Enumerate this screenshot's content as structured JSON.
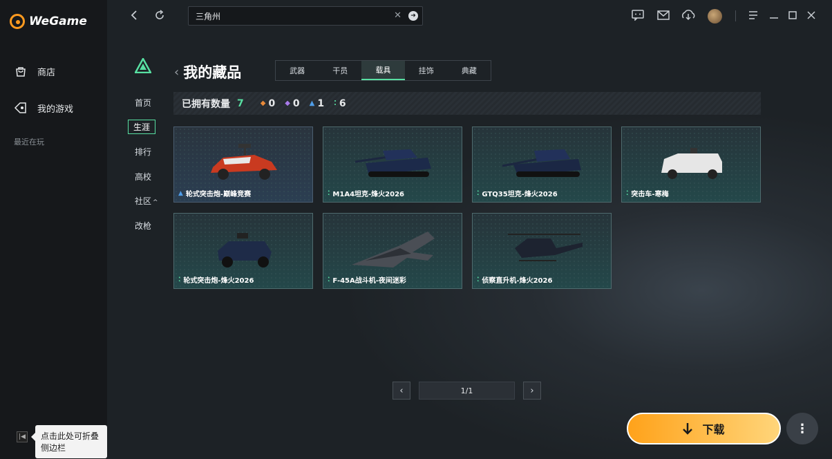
{
  "sidebar": {
    "brand": "WeGame",
    "items": [
      {
        "label": "商店",
        "icon": "shop-bag-icon"
      },
      {
        "label": "我的游戏",
        "icon": "game-controller-icon"
      }
    ],
    "recent_label": "最近在玩",
    "collapse_tooltip": "点击此处可折叠侧边栏"
  },
  "topbar": {
    "search_value": "三角州"
  },
  "game_menu": {
    "items": [
      "首页",
      "生涯",
      "排行",
      "高校",
      "社区",
      "改枪"
    ],
    "active": "生涯"
  },
  "page": {
    "title": "我的藏品",
    "tabs": [
      "武器",
      "干员",
      "载具",
      "挂饰",
      "典藏"
    ],
    "active_tab": "载具",
    "stats": {
      "owned_label": "已拥有数量",
      "owned_count": "7",
      "orange": "0",
      "purple": "0",
      "blue": "1",
      "green": "6"
    }
  },
  "items": [
    {
      "name": "轮式突击炮-巅峰竞赛",
      "rarity": "blue"
    },
    {
      "name": "M1A4坦克-烽火2026",
      "rarity": "green"
    },
    {
      "name": "GTQ35坦克-烽火2026",
      "rarity": "green"
    },
    {
      "name": "突击车-寒梅",
      "rarity": "green"
    },
    {
      "name": "轮式突击炮-烽火2026",
      "rarity": "green"
    },
    {
      "name": "F-45A战斗机-夜间迷彩",
      "rarity": "green"
    },
    {
      "name": "侦察直升机-烽火2026",
      "rarity": "green"
    }
  ],
  "pagination": {
    "text": "1/1"
  },
  "actions": {
    "download": "下载"
  },
  "colors": {
    "accent": "#58e0a2",
    "download": "#ffb338",
    "orange": "#e88a3a",
    "purple": "#a87bea",
    "blue": "#4f9de8",
    "green": "#58e0a2"
  }
}
